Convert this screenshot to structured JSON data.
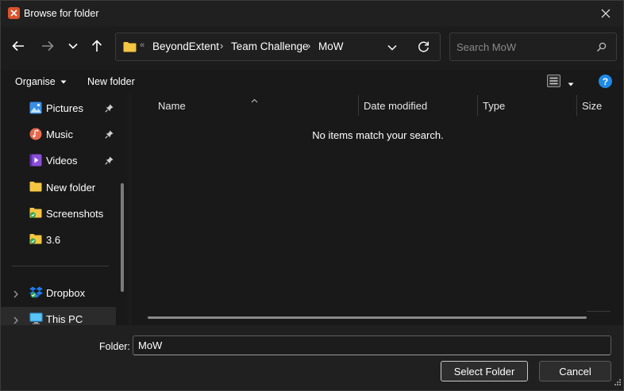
{
  "window": {
    "title": "Browse for folder"
  },
  "nav": {
    "breadcrumbs": [
      {
        "label": "BeyondExtent"
      },
      {
        "label": "Team Challenge"
      },
      {
        "label": "MoW"
      }
    ],
    "search_placeholder": "Search MoW"
  },
  "toolbar": {
    "organise_label": "Organise",
    "new_folder_label": "New folder",
    "help_label": "?"
  },
  "sidebar": {
    "items": [
      {
        "label": "Pictures",
        "icon": "pictures-icon",
        "pinned": true
      },
      {
        "label": "Music",
        "icon": "music-icon",
        "pinned": true
      },
      {
        "label": "Videos",
        "icon": "videos-icon",
        "pinned": true
      },
      {
        "label": "New folder",
        "icon": "folder-icon",
        "pinned": false
      },
      {
        "label": "Screenshots",
        "icon": "folder-synced-icon",
        "pinned": false
      },
      {
        "label": "3.6",
        "icon": "folder-synced-icon",
        "pinned": false
      }
    ],
    "locations": [
      {
        "label": "Dropbox",
        "icon": "dropbox-icon"
      },
      {
        "label": "This PC",
        "icon": "pc-icon"
      }
    ]
  },
  "content": {
    "columns": [
      "Name",
      "Date modified",
      "Type",
      "Size"
    ],
    "empty_message": "No items match your search."
  },
  "footer": {
    "folder_label": "Folder:",
    "folder_value": "MoW",
    "select_button": "Select Folder",
    "cancel_button": "Cancel"
  },
  "colors": {
    "accent": "#1e8ae8",
    "folder": "#f4c542",
    "app_icon": "#d9532c"
  }
}
